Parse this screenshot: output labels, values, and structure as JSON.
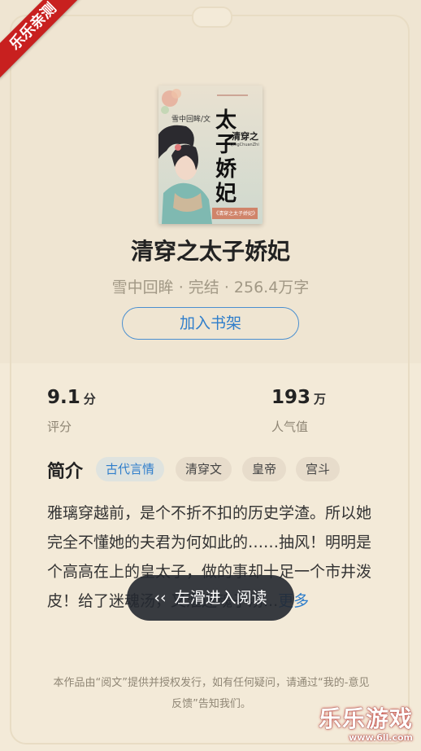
{
  "ribbon": {
    "label": "乐乐亲测"
  },
  "book": {
    "cover": {
      "author_label": "雪中回眸/文",
      "title_text": "太子娇妃",
      "subtitle_text": "清穿之",
      "pinyin": "QingChuanZhi",
      "footer_text": "《清穿之太子娇妃》"
    },
    "title": "清穿之太子娇妃",
    "meta": "雪中回眸 · 完结 · 256.4万字",
    "add_shelf_label": "加入书架"
  },
  "stats": {
    "rating": {
      "value": "9.1",
      "unit": "分",
      "label": "评分"
    },
    "popularity": {
      "value": "193",
      "unit": "万",
      "label": "人气值"
    }
  },
  "intro": {
    "heading": "简介",
    "tags": [
      "古代言情",
      "清穿文",
      "皇帝",
      "宫斗"
    ],
    "text": "雅璃穿越前，是个不折不扣的历史学渣。所以她完全不懂她的夫君为何如此的……抽风！明明是个高高在上的皇太子，做的事却十足一个市井泼皮！给了迷魂汤，又灌迷魂子汤...",
    "more_label": "更多"
  },
  "toast": {
    "label": "左滑进入阅读",
    "icon": "double-chevron-left-icon"
  },
  "footer": {
    "text": "本作品由“阅文”提供并授权发行，如有任何疑问，请通过“我的-意见反馈”告知我们。"
  },
  "watermark": {
    "main": "乐乐游戏",
    "sub": "www.6ll.com"
  }
}
